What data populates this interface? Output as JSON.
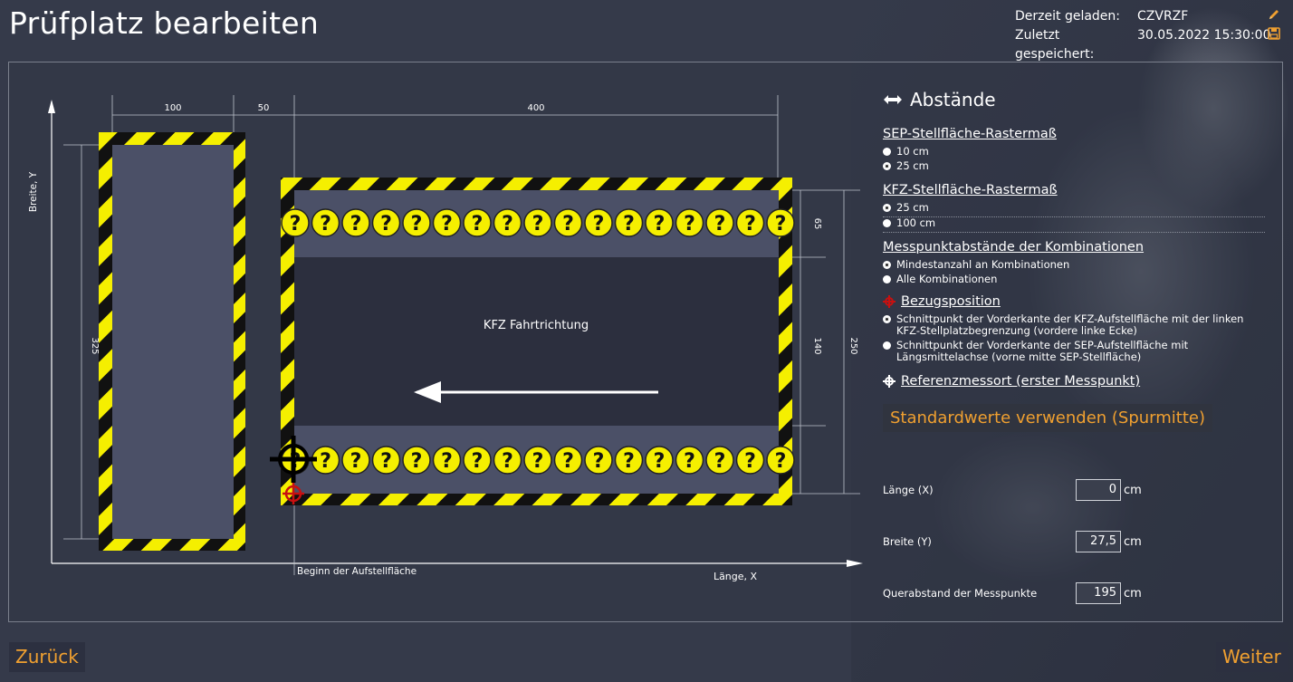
{
  "title": "Prüfplatz bearbeiten",
  "status": {
    "loaded_label": "Derzeit geladen:",
    "loaded_value": "CZVRZF",
    "saved_label": "Zuletzt gespeichert:",
    "saved_value": "30.05.2022 15:30:00"
  },
  "drawing": {
    "dim_100": "100",
    "dim_50": "50",
    "dim_400": "400",
    "dim_325": "325",
    "dim_65": "65",
    "dim_140": "140",
    "dim_250": "250",
    "axis_y": "Breite, Y",
    "axis_x": "Länge, X",
    "direction": "KFZ Fahrtrichtung",
    "start_label": "Beginn der Aufstellfläche",
    "marker_glyph": "?"
  },
  "side": {
    "heading": "Abstände",
    "sep_head": "SEP-Stellfläche-Rastermaß",
    "sep_opts": [
      "10 cm",
      "25 cm"
    ],
    "kfz_head": "KFZ-Stellfläche-Rastermaß",
    "kfz_opts": [
      "25 cm",
      "100 cm"
    ],
    "mess_head": "Messpunktabstände der Kombinationen",
    "mess_opts": [
      "Mindestanzahl an Kombinationen",
      "Alle Kombinationen"
    ],
    "bezug_head": "Bezugsposition",
    "bezug_opts": [
      "Schnittpunkt der Vorderkante der KFZ-Aufstellfläche mit der linken KFZ-Stellplatzbegrenzung (vordere linke Ecke)",
      "Schnittpunkt der Vorderkante der SEP-Aufstellfläche mit Längsmittelachse (vorne mitte SEP-Stellfläche)"
    ],
    "ref_head": "Referenzmessort (erster Messpunkt)",
    "std_button": "Standardwerte verwenden (Spurmitte)",
    "laenge_label": "Länge (X)",
    "laenge_value": "0",
    "breite_label": "Breite (Y)",
    "breite_value": "27,5",
    "quer_label": "Querabstand der Messpunkte",
    "quer_value": "195",
    "unit": "cm"
  },
  "nav": {
    "back": "Zurück",
    "next": "Weiter"
  },
  "colors": {
    "accent": "#f0a030",
    "stripe_yellow": "#f5ef00",
    "marker_red": "#c81010"
  }
}
